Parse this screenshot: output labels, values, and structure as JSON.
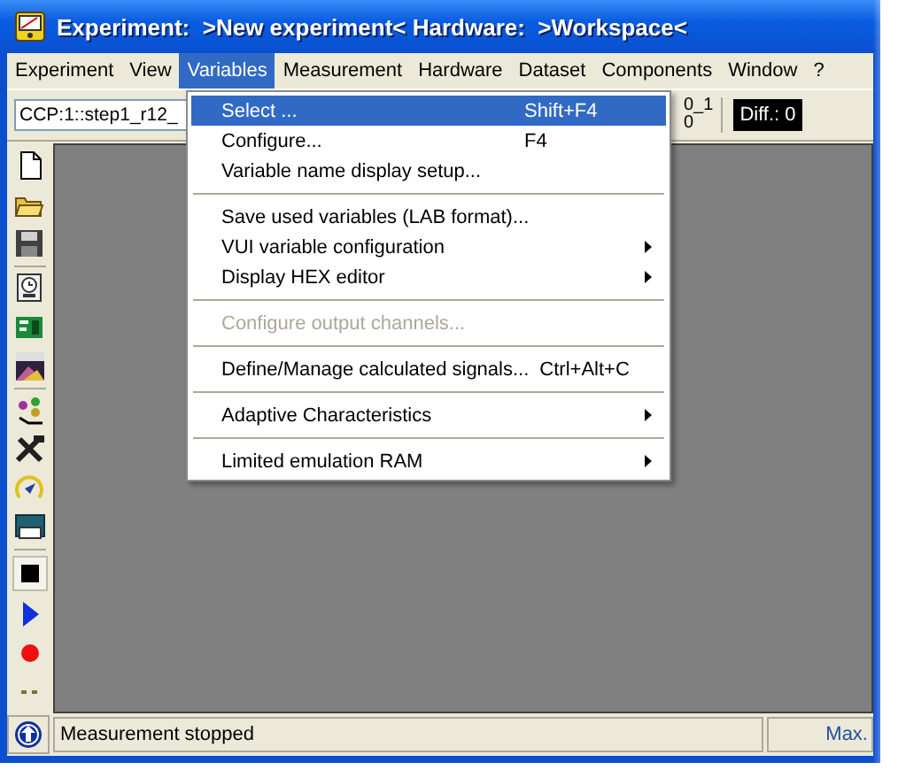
{
  "window": {
    "title": "Experiment:  >New experiment< Hardware:  >Workspace<"
  },
  "menubar": [
    {
      "label": "Experiment",
      "selected": false
    },
    {
      "label": "View",
      "selected": false
    },
    {
      "label": "Variables",
      "selected": true
    },
    {
      "label": "Measurement",
      "selected": false
    },
    {
      "label": "Hardware",
      "selected": false
    },
    {
      "label": "Dataset",
      "selected": false
    },
    {
      "label": "Components",
      "selected": false
    },
    {
      "label": "Window",
      "selected": false
    },
    {
      "label": "?",
      "selected": false
    }
  ],
  "toolbar": {
    "combo": "CCP:1::step1_r12_",
    "partial_lines": [
      "0_1",
      "0"
    ],
    "diff": "Diff.: 0"
  },
  "menu": {
    "items": [
      {
        "kind": "item",
        "label": "Select  ...",
        "shortcut": "Shift+F4",
        "selected": true,
        "disabled": false,
        "submenu": false
      },
      {
        "kind": "item",
        "label": "Configure...",
        "shortcut": "F4",
        "selected": false,
        "disabled": false,
        "submenu": false
      },
      {
        "kind": "item",
        "label": "Variable name display setup...",
        "selected": false,
        "disabled": false,
        "submenu": false
      },
      {
        "kind": "separator"
      },
      {
        "kind": "item",
        "label": "Save used variables (LAB format)...",
        "selected": false,
        "disabled": false,
        "submenu": false
      },
      {
        "kind": "item",
        "label": "VUI variable configuration",
        "selected": false,
        "disabled": false,
        "submenu": true
      },
      {
        "kind": "item",
        "label": "Display HEX editor",
        "selected": false,
        "disabled": false,
        "submenu": true
      },
      {
        "kind": "separator"
      },
      {
        "kind": "item",
        "label": "Configure output channels...",
        "selected": false,
        "disabled": true,
        "submenu": false
      },
      {
        "kind": "separator"
      },
      {
        "kind": "item",
        "label": "Define/Manage calculated signals...",
        "shortcut": "Ctrl+Alt+C",
        "selected": false,
        "disabled": false,
        "submenu": false
      },
      {
        "kind": "separator"
      },
      {
        "kind": "item",
        "label": "Adaptive Characteristics",
        "selected": false,
        "disabled": false,
        "submenu": true
      },
      {
        "kind": "separator"
      },
      {
        "kind": "item",
        "label": "Limited emulation RAM",
        "selected": false,
        "disabled": false,
        "submenu": true
      }
    ]
  },
  "status_bar": {
    "message": "Measurement stopped",
    "right": "Max."
  }
}
